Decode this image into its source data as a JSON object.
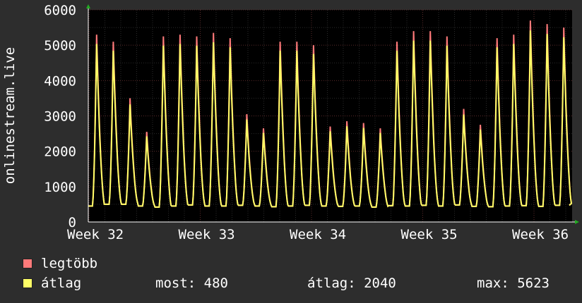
{
  "chart_data": {
    "type": "line",
    "ylabel": "onlinestream.live",
    "ylim": [
      0,
      6000
    ],
    "yticks": [
      0,
      1000,
      2000,
      3000,
      4000,
      5000,
      6000
    ],
    "xticks": [
      "Week 32",
      "Week 33",
      "Week 34",
      "Week 35",
      "Week 36"
    ],
    "grid": true,
    "peaks": [
      5300,
      5100,
      3500,
      2550,
      5250,
      5300,
      5250,
      5350,
      5200,
      3050,
      2650,
      5100,
      5100,
      5000,
      2700,
      2850,
      2800,
      2650,
      5100,
      5400,
      5400,
      5250,
      3200,
      2750,
      5200,
      5300,
      5700,
      5600,
      5500
    ],
    "troughs": [
      450,
      500,
      500,
      450,
      420,
      450,
      480,
      450,
      450,
      470,
      450,
      430,
      450,
      470,
      450,
      440,
      450,
      420,
      460,
      450,
      470,
      450,
      480,
      440,
      430,
      450,
      460,
      440,
      470
    ],
    "series": [
      {
        "name": "legtöbb",
        "color": "#ff7a7a"
      },
      {
        "name": "átlag",
        "color": "#ffff66"
      }
    ]
  },
  "legend": {
    "max_label": "legtöbb",
    "avg_label": "átlag",
    "max_color": "#ff7a7a",
    "avg_color": "#ffff66"
  },
  "stats": {
    "now": "most: 480",
    "average": "átlag: 2040",
    "maximum": "max: 5623"
  }
}
